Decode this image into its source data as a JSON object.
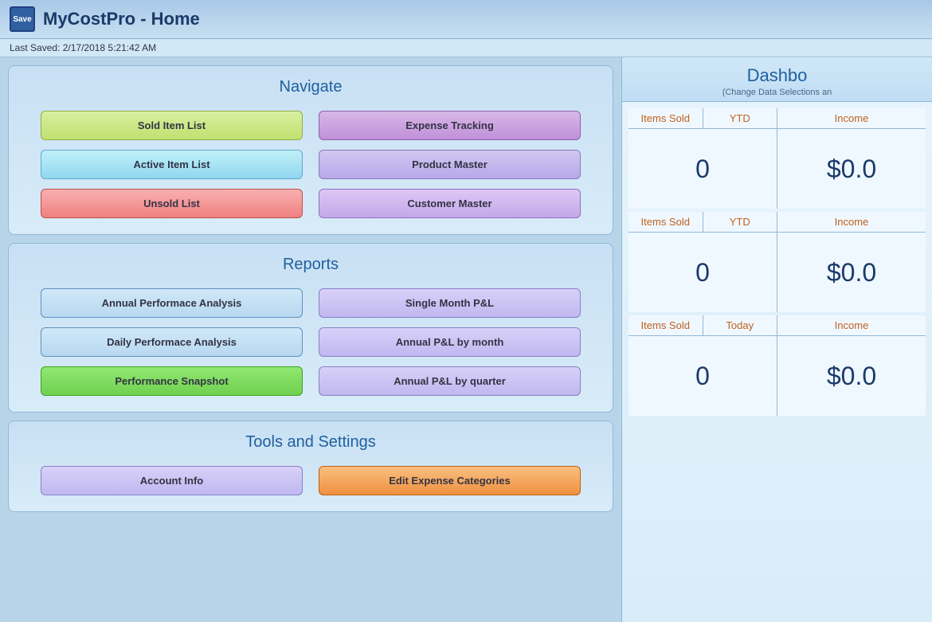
{
  "app": {
    "title": "MyCostPro  - Home",
    "save_icon_label": "Save",
    "last_saved": "Last Saved:  2/17/2018 5:21:42 AM"
  },
  "navigate": {
    "section_title": "Navigate",
    "buttons": {
      "sold_item": "Sold Item List",
      "expense_tracking": "Expense Tracking",
      "active_item": "Active Item List",
      "product_master": "Product Master",
      "unsold_list": "Unsold List",
      "customer_master": "Customer Master"
    }
  },
  "reports": {
    "section_title": "Reports",
    "buttons": {
      "annual_performance": "Annual Performace Analysis",
      "single_month": "Single Month P&L",
      "daily_performance": "Daily Performace Analysis",
      "annual_pl_month": "Annual P&L by month",
      "performance_snapshot": "Performance Snapshot",
      "annual_pl_quarter": "Annual P&L by quarter"
    }
  },
  "tools": {
    "section_title": "Tools and Settings",
    "buttons": {
      "account_info": "Account Info",
      "edit_expense": "Edit Expense Categories"
    }
  },
  "dashboard": {
    "title": "Dashbo",
    "subtitle": "(Change Data Selections an",
    "row1": {
      "left_header1": "Items Sold",
      "left_header2": "YTD",
      "left_value1": "0",
      "right_header1": "Income",
      "right_value1": "$0.0"
    },
    "row2": {
      "left_header1": "Items Sold",
      "left_header2": "YTD",
      "left_value1": "0",
      "right_header1": "Income",
      "right_value1": "$0.0"
    },
    "row3": {
      "left_header1": "Items Sold",
      "left_header2": "Today",
      "left_value1": "0",
      "right_header1": "Income",
      "right_value1": "$0.0"
    }
  }
}
